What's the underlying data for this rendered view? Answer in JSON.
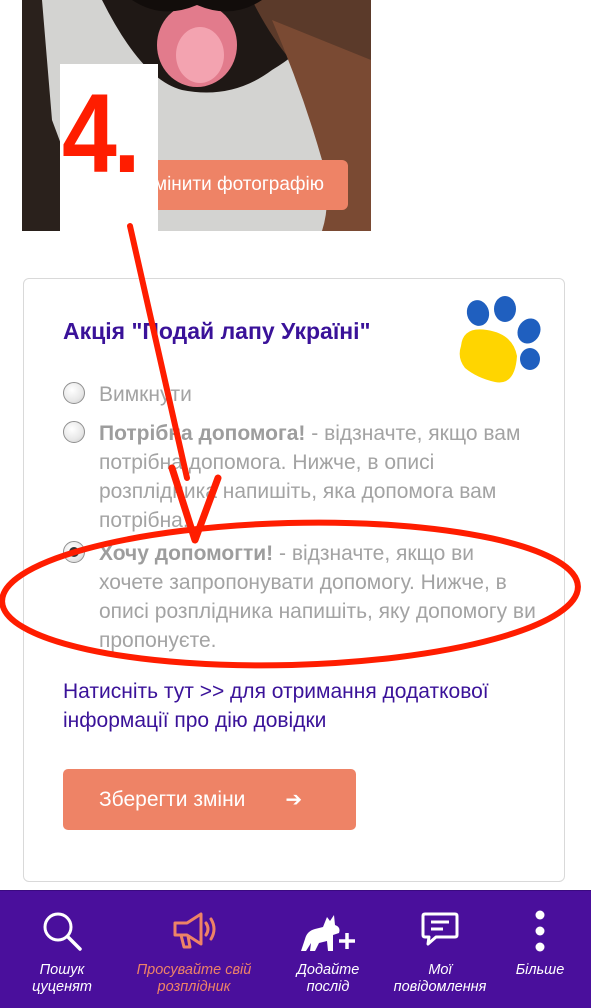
{
  "photo_section": {
    "change_photo_label": "Змінити фотографію"
  },
  "annotation": {
    "step_number": "4."
  },
  "promo": {
    "title": "Акція \"Подай лапу Україні\"",
    "options": [
      {
        "bold": "",
        "text": "Вимкнути",
        "checked": false
      },
      {
        "bold": "Потрібна допомога!",
        "text": " - відзначте, якщо вам потрібна допомога. Нижче, в описі розплідника напишіть, яка допомога вам потрібна.",
        "checked": false
      },
      {
        "bold": "Хочу допомогти!",
        "text": " - відзначте, якщо ви хочете запропонувати допомогу. Нижче, в описі розплідника напишіть, яку допомогу ви пропонуєте.",
        "checked": true
      }
    ],
    "info_link": "Натисніть тут >> для отримання додаткової інформації про дію довідки",
    "save_label": "Зберегти зміни",
    "save_arrow": "➔"
  },
  "bottom_nav": {
    "items": [
      {
        "label": "Пошук цуценят",
        "icon": "search-icon"
      },
      {
        "label": "Просувайте свій розплідник",
        "icon": "megaphone-icon"
      },
      {
        "label": "Додайте послід",
        "icon": "add-litter-icon"
      },
      {
        "label": "Мої повідомлення",
        "icon": "messages-icon"
      },
      {
        "label": "Більше",
        "icon": "more-icon"
      }
    ]
  },
  "colors": {
    "brand_purple": "#3a1299",
    "nav_bg": "#4a0f9c",
    "accent_orange": "#ee8366",
    "annotation_red": "#ff1d00",
    "paw_blue": "#1f5fbf",
    "paw_yellow": "#ffd500"
  }
}
